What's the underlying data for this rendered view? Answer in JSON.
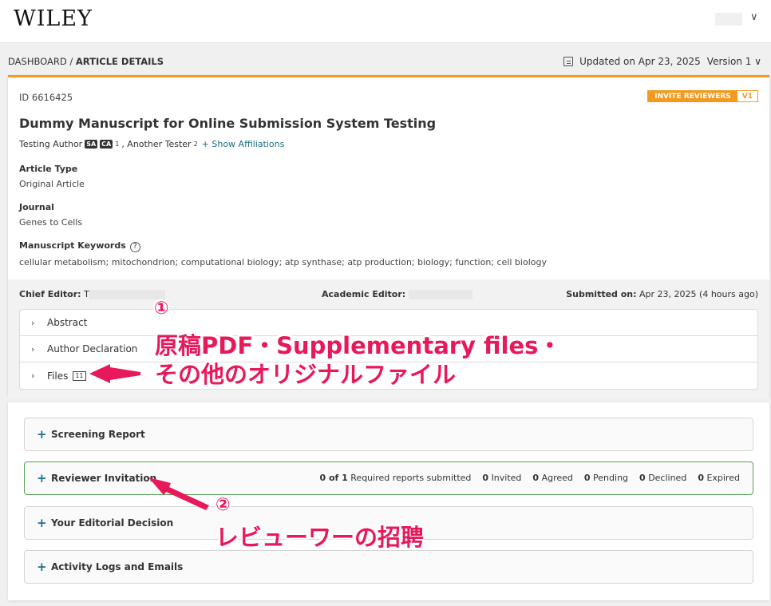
{
  "header": {
    "logo": "WILEY",
    "user_chevron": "∨"
  },
  "breadcrumb": {
    "dashboard": "DASHBOARD",
    "separator": " / ",
    "current": "ARTICLE DETAILS"
  },
  "version_bar": {
    "updated": "Updated on Apr 23, 2025",
    "version": "Version 1",
    "version_chevron": "∨"
  },
  "manuscript": {
    "id": "ID 6616425",
    "invite_label": "INVITE REVIEWERS",
    "invite_version": "V1",
    "title": "Dummy Manuscript for Online Submission System Testing",
    "author1": "Testing Author",
    "tag_sa": "SA",
    "tag_ca": "CA",
    "author1_sup": "1",
    "author2": ", Another Tester",
    "author2_sup": "2",
    "show_affiliations": "+ Show Affiliations",
    "article_type_label": "Article Type",
    "article_type_value": "Original Article",
    "journal_label": "Journal",
    "journal_value": "Genes to Cells",
    "keywords_label": "Manuscript Keywords",
    "keywords_help": "?",
    "keywords_value": "cellular metabolism; mitochondrion; computational biology; atp synthase; atp production; biology; function; cell biology"
  },
  "editors": {
    "chief_label": "Chief Editor:",
    "chief_initial": "T",
    "academic_label": "Academic Editor:",
    "submitted_label": "Submitted on:",
    "submitted_value": "Apr 23, 2025 (4 hours ago)"
  },
  "accordion": {
    "abstract": "Abstract",
    "author_declaration": "Author Declaration",
    "files": "Files",
    "files_count": "11",
    "chevron": "›"
  },
  "panels": {
    "plus": "+",
    "screening": "Screening Report",
    "reviewer_invitation": "Reviewer Invitation",
    "editorial_decision": "Your Editorial Decision",
    "activity_logs": "Activity Logs and Emails"
  },
  "reviewer_stats": {
    "required_num": "0 of 1",
    "required_text": "Required reports submitted",
    "invited_num": "0",
    "invited_text": "Invited",
    "agreed_num": "0",
    "agreed_text": "Agreed",
    "pending_num": "0",
    "pending_text": "Pending",
    "declined_num": "0",
    "declined_text": "Declined",
    "expired_num": "0",
    "expired_text": "Expired"
  },
  "annotations": {
    "num1": "①",
    "text1_line1": "原稿PDF・Supplementary files・",
    "text1_line2": "その他のオリジナルファイル",
    "num2": "②",
    "text2": "レビューワーの招聘",
    "color": "#e8195a"
  },
  "colors": {
    "accent_orange": "#f39a1e",
    "link_teal": "#1e6f87",
    "green_border": "#5aa05a"
  }
}
